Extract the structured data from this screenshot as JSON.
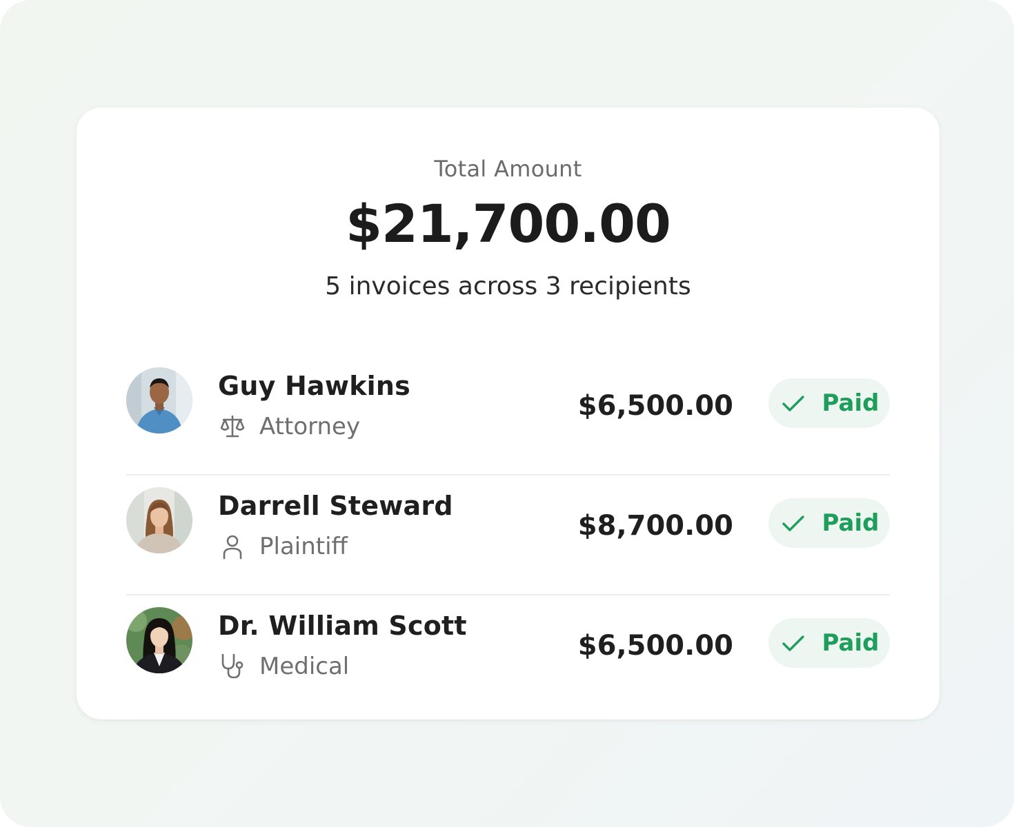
{
  "summary": {
    "label": "Total Amount",
    "total": "$21,700.00",
    "description": "5 invoices across 3 recipients"
  },
  "colors": {
    "status_green": "#1f9d5c",
    "status_bg": "#eef6f1"
  },
  "recipients": [
    {
      "name": "Guy Hawkins",
      "role": "Attorney",
      "role_icon": "scale-icon",
      "amount": "$6,500.00",
      "status": "Paid",
      "status_icon": "check-icon"
    },
    {
      "name": "Darrell Steward",
      "role": "Plaintiff",
      "role_icon": "person-icon",
      "amount": "$8,700.00",
      "status": "Paid",
      "status_icon": "check-icon"
    },
    {
      "name": "Dr. William Scott",
      "role": "Medical",
      "role_icon": "stethoscope-icon",
      "amount": "$6,500.00",
      "status": "Paid",
      "status_icon": "check-icon"
    }
  ]
}
